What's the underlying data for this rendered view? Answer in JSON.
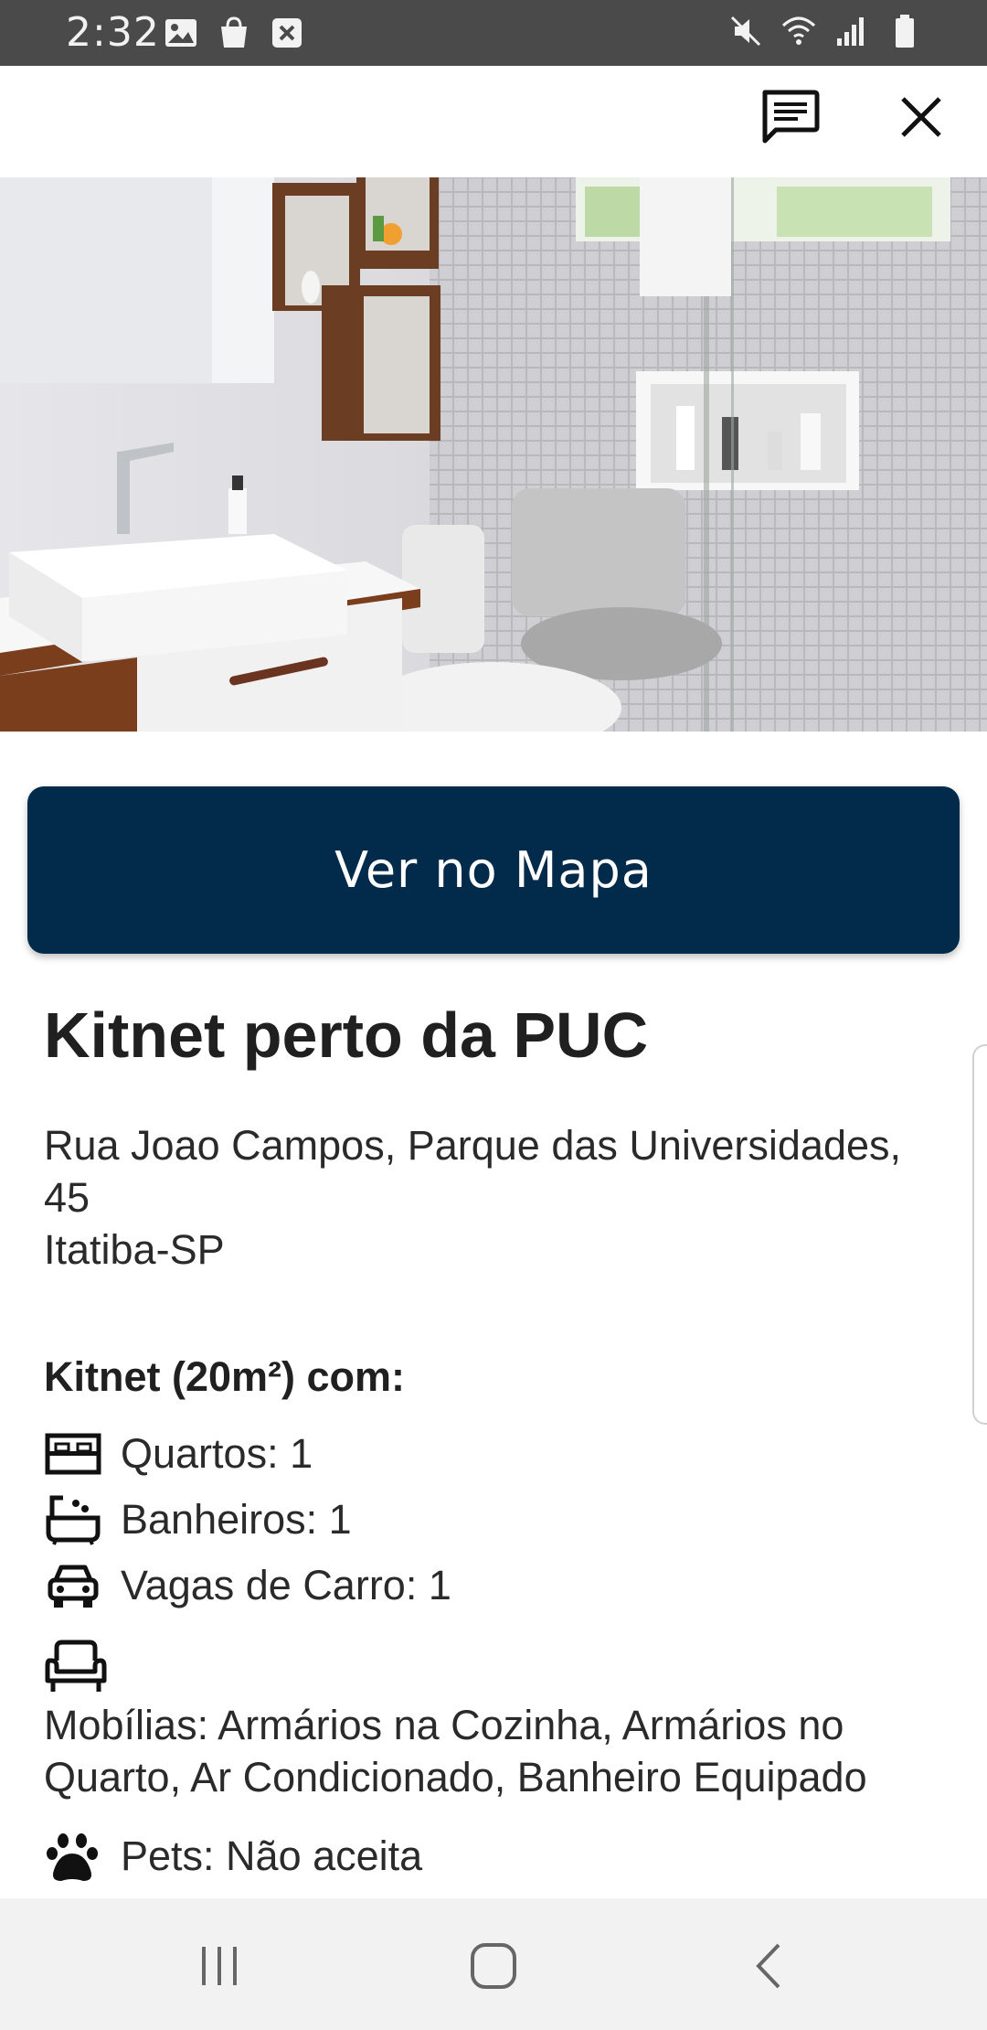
{
  "status_bar": {
    "time": "2:32",
    "left_icons": [
      "image-icon",
      "shopping-bag-icon",
      "close-box-icon"
    ],
    "right_icons": [
      "mute-icon",
      "wifi-icon",
      "signal-icon",
      "battery-icon"
    ]
  },
  "header": {
    "icons": [
      "chat-icon",
      "close-icon"
    ]
  },
  "photo": {
    "icon": "bathroom-photo"
  },
  "map_button": {
    "label": "Ver no Mapa"
  },
  "listing": {
    "title": "Kitnet perto da PUC",
    "address_line1": "Rua Joao Campos, Parque das Universidades, 45",
    "address_line2": "Itatiba-SP",
    "heading": "Kitnet (20m²) com:",
    "features": {
      "quartos": "Quartos: 1",
      "banheiros": "Banheiros: 1",
      "vagas": "Vagas de Carro: 1",
      "mobilias": " Mobílias: Armários na Cozinha, Armários no Quarto, Ar Condicionado, Banheiro Equipado",
      "pets": "Pets: Não aceita"
    }
  },
  "nav_bar": {
    "buttons": [
      "recents-icon",
      "home-icon",
      "back-icon"
    ]
  },
  "colors": {
    "status_bar": "#4a4a4a",
    "button_bg": "#022a4a",
    "nav_bar": "#f2f2f2"
  }
}
